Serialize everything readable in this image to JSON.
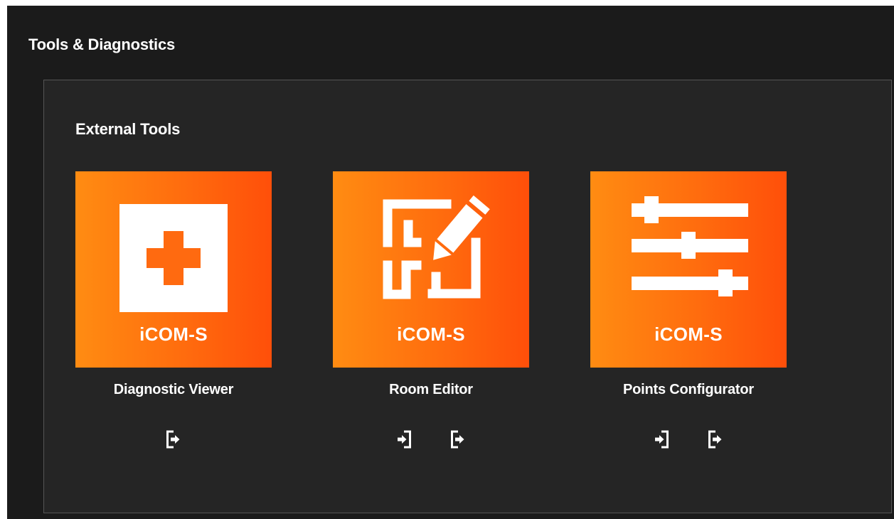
{
  "header": {
    "title": "Tools & Diagnostics"
  },
  "section": {
    "title": "External Tools"
  },
  "tools": [
    {
      "name": "Diagnostic Viewer",
      "brand": "iCOM-S",
      "icon": "medical-cross-icon",
      "actions": [
        "export-icon"
      ]
    },
    {
      "name": "Room Editor",
      "brand": "iCOM-S",
      "icon": "room-edit-icon",
      "actions": [
        "import-icon",
        "export-icon"
      ]
    },
    {
      "name": "Points Configurator",
      "brand": "iCOM-S",
      "icon": "sliders-icon",
      "actions": [
        "import-icon",
        "export-icon"
      ]
    }
  ],
  "colors": {
    "tile_gradient_start": "#ff8c12",
    "tile_gradient_end": "#ff4f0a",
    "page_background": "#1b1b1b",
    "panel_background": "#252525",
    "panel_border": "#555555"
  }
}
